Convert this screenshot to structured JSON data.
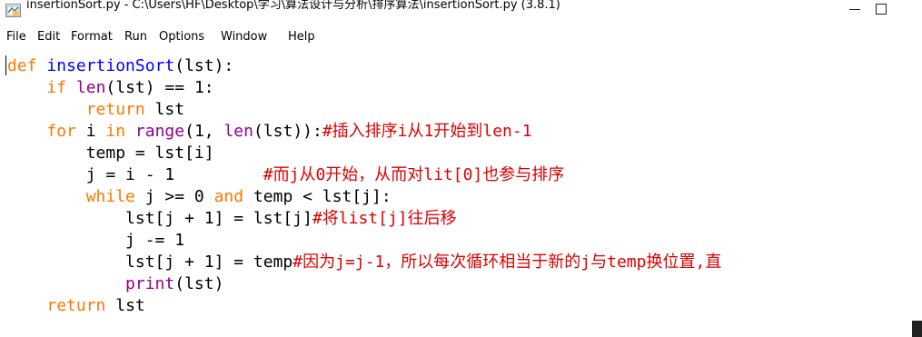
{
  "window": {
    "title": "insertionSort.py - C:\\Users\\HF\\Desktop\\学习\\算法设计与分析\\排序算法\\insertionSort.py (3.8.1)"
  },
  "menu": [
    {
      "label": "File"
    },
    {
      "label": "Edit"
    },
    {
      "label": "Format"
    },
    {
      "label": "Run"
    },
    {
      "label": "Options"
    },
    {
      "label": "Window"
    },
    {
      "label": "Help"
    }
  ],
  "syntax_colors": {
    "keyword": "#ff7700",
    "definition": "#0000ff",
    "builtin": "#900090",
    "comment": "#dd0000",
    "default": "#000000"
  },
  "code": [
    [
      {
        "t": "def",
        "c": "kw"
      },
      {
        "t": " "
      },
      {
        "t": "insertionSort",
        "c": "def"
      },
      {
        "t": "(lst):"
      }
    ],
    [
      {
        "t": "    "
      },
      {
        "t": "if",
        "c": "kw"
      },
      {
        "t": " "
      },
      {
        "t": "len",
        "c": "bi"
      },
      {
        "t": "(lst) == 1:"
      }
    ],
    [
      {
        "t": "        "
      },
      {
        "t": "return",
        "c": "kw"
      },
      {
        "t": " lst"
      }
    ],
    [
      {
        "t": "    "
      },
      {
        "t": "for",
        "c": "kw"
      },
      {
        "t": " i "
      },
      {
        "t": "in",
        "c": "kw"
      },
      {
        "t": " "
      },
      {
        "t": "range",
        "c": "bi"
      },
      {
        "t": "(1, "
      },
      {
        "t": "len",
        "c": "bi"
      },
      {
        "t": "(lst)):"
      },
      {
        "t": "#插入排序i从1开始到len-1",
        "c": "cm"
      }
    ],
    [
      {
        "t": "        temp = lst[i]"
      }
    ],
    [
      {
        "t": "        j = i - 1         "
      },
      {
        "t": "#而j从0开始，从而对lit[0]也参与排序",
        "c": "cm"
      }
    ],
    [
      {
        "t": "        "
      },
      {
        "t": "while",
        "c": "kw"
      },
      {
        "t": " j >= 0 "
      },
      {
        "t": "and",
        "c": "kw"
      },
      {
        "t": " temp < lst[j]:"
      }
    ],
    [
      {
        "t": "            lst[j + 1] = lst[j]"
      },
      {
        "t": "#将list[j]往后移",
        "c": "cm"
      }
    ],
    [
      {
        "t": "            j -= 1"
      }
    ],
    [
      {
        "t": "            lst[j + 1] = temp"
      },
      {
        "t": "#因为j=j-1，所以每次循环相当于新的j与temp换位置,直",
        "c": "cm"
      }
    ],
    [
      {
        "t": "            "
      },
      {
        "t": "print",
        "c": "bi"
      },
      {
        "t": "(lst)"
      }
    ],
    [
      {
        "t": "    "
      },
      {
        "t": "return",
        "c": "kw"
      },
      {
        "t": " lst"
      }
    ]
  ]
}
